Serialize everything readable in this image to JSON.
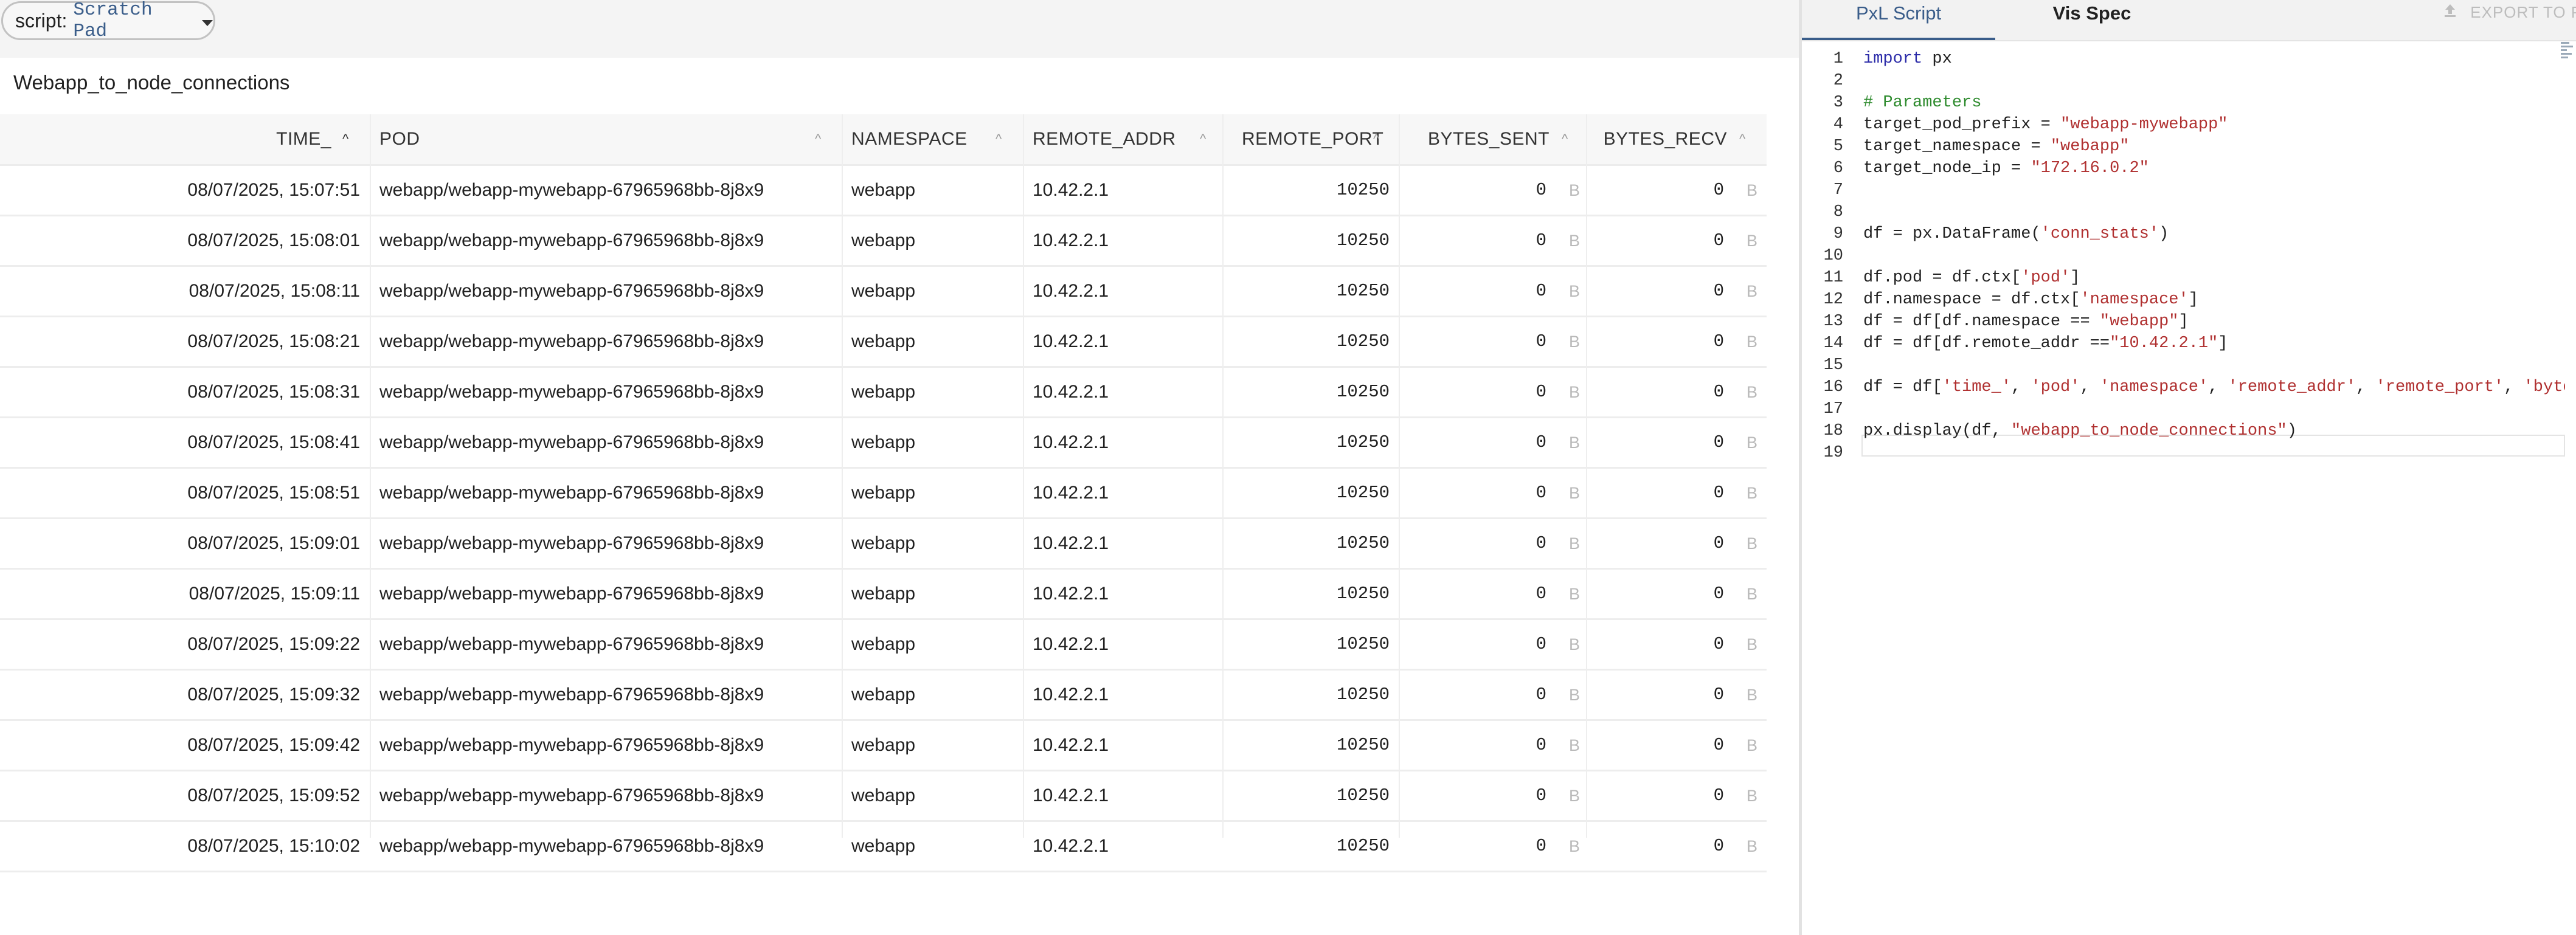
{
  "script_selector": {
    "prefix": "script:",
    "value": "Scratch Pad"
  },
  "table": {
    "title": "Webapp_to_node_connections",
    "columns": [
      "TIME_",
      "POD",
      "NAMESPACE",
      "REMOTE_ADDR",
      "REMOTE_PORT",
      "BYTES_SENT",
      "BYTES_RECV"
    ],
    "byte_unit": "B",
    "rows": [
      [
        "08/07/2025, 15:07:51",
        "webapp/webapp-mywebapp-67965968bb-8j8x9",
        "webapp",
        "10.42.2.1",
        "10250",
        "0",
        "0"
      ],
      [
        "08/07/2025, 15:08:01",
        "webapp/webapp-mywebapp-67965968bb-8j8x9",
        "webapp",
        "10.42.2.1",
        "10250",
        "0",
        "0"
      ],
      [
        "08/07/2025, 15:08:11",
        "webapp/webapp-mywebapp-67965968bb-8j8x9",
        "webapp",
        "10.42.2.1",
        "10250",
        "0",
        "0"
      ],
      [
        "08/07/2025, 15:08:21",
        "webapp/webapp-mywebapp-67965968bb-8j8x9",
        "webapp",
        "10.42.2.1",
        "10250",
        "0",
        "0"
      ],
      [
        "08/07/2025, 15:08:31",
        "webapp/webapp-mywebapp-67965968bb-8j8x9",
        "webapp",
        "10.42.2.1",
        "10250",
        "0",
        "0"
      ],
      [
        "08/07/2025, 15:08:41",
        "webapp/webapp-mywebapp-67965968bb-8j8x9",
        "webapp",
        "10.42.2.1",
        "10250",
        "0",
        "0"
      ],
      [
        "08/07/2025, 15:08:51",
        "webapp/webapp-mywebapp-67965968bb-8j8x9",
        "webapp",
        "10.42.2.1",
        "10250",
        "0",
        "0"
      ],
      [
        "08/07/2025, 15:09:01",
        "webapp/webapp-mywebapp-67965968bb-8j8x9",
        "webapp",
        "10.42.2.1",
        "10250",
        "0",
        "0"
      ],
      [
        "08/07/2025, 15:09:11",
        "webapp/webapp-mywebapp-67965968bb-8j8x9",
        "webapp",
        "10.42.2.1",
        "10250",
        "0",
        "0"
      ],
      [
        "08/07/2025, 15:09:22",
        "webapp/webapp-mywebapp-67965968bb-8j8x9",
        "webapp",
        "10.42.2.1",
        "10250",
        "0",
        "0"
      ],
      [
        "08/07/2025, 15:09:32",
        "webapp/webapp-mywebapp-67965968bb-8j8x9",
        "webapp",
        "10.42.2.1",
        "10250",
        "0",
        "0"
      ],
      [
        "08/07/2025, 15:09:42",
        "webapp/webapp-mywebapp-67965968bb-8j8x9",
        "webapp",
        "10.42.2.1",
        "10250",
        "0",
        "0"
      ],
      [
        "08/07/2025, 15:09:52",
        "webapp/webapp-mywebapp-67965968bb-8j8x9",
        "webapp",
        "10.42.2.1",
        "10250",
        "0",
        "0"
      ],
      [
        "08/07/2025, 15:10:02",
        "webapp/webapp-mywebapp-67965968bb-8j8x9",
        "webapp",
        "10.42.2.1",
        "10250",
        "0",
        "0"
      ]
    ]
  },
  "editor_tabs": {
    "pxl_script": "PxL Script",
    "vis_spec": "Vis Spec",
    "export": "EXPORT TO P"
  },
  "code_lines": [
    [
      {
        "t": "import",
        "c": "kw"
      },
      {
        "t": " px",
        "c": ""
      }
    ],
    [],
    [
      {
        "t": "# Parameters",
        "c": "cm"
      }
    ],
    [
      {
        "t": "target_pod_prefix = ",
        "c": ""
      },
      {
        "t": "\"webapp-mywebapp\"",
        "c": "str"
      }
    ],
    [
      {
        "t": "target_namespace = ",
        "c": ""
      },
      {
        "t": "\"webapp\"",
        "c": "str"
      }
    ],
    [
      {
        "t": "target_node_ip = ",
        "c": ""
      },
      {
        "t": "\"172.16.0.2\"",
        "c": "str"
      }
    ],
    [],
    [],
    [
      {
        "t": "df = px.DataFrame(",
        "c": ""
      },
      {
        "t": "'conn_stats'",
        "c": "str"
      },
      {
        "t": ")",
        "c": ""
      }
    ],
    [],
    [
      {
        "t": "df.pod = df.ctx[",
        "c": ""
      },
      {
        "t": "'pod'",
        "c": "str"
      },
      {
        "t": "]",
        "c": ""
      }
    ],
    [
      {
        "t": "df.namespace = df.ctx[",
        "c": ""
      },
      {
        "t": "'namespace'",
        "c": "str"
      },
      {
        "t": "]",
        "c": ""
      }
    ],
    [
      {
        "t": "df = df[df.namespace == ",
        "c": ""
      },
      {
        "t": "\"webapp\"",
        "c": "str"
      },
      {
        "t": "]",
        "c": ""
      }
    ],
    [
      {
        "t": "df = df[df.remote_addr ==",
        "c": ""
      },
      {
        "t": "\"10.42.2.1\"",
        "c": "str"
      },
      {
        "t": "]",
        "c": ""
      }
    ],
    [],
    [
      {
        "t": "df = df[",
        "c": ""
      },
      {
        "t": "'time_'",
        "c": "str"
      },
      {
        "t": ", ",
        "c": ""
      },
      {
        "t": "'pod'",
        "c": "str"
      },
      {
        "t": ", ",
        "c": ""
      },
      {
        "t": "'namespace'",
        "c": "str"
      },
      {
        "t": ", ",
        "c": ""
      },
      {
        "t": "'remote_addr'",
        "c": "str"
      },
      {
        "t": ", ",
        "c": ""
      },
      {
        "t": "'remote_port'",
        "c": "str"
      },
      {
        "t": ", ",
        "c": ""
      },
      {
        "t": "'bytes_sent'",
        "c": "str"
      }
    ],
    [],
    [
      {
        "t": "px.display(df, ",
        "c": ""
      },
      {
        "t": "\"webapp_to_node_connections\"",
        "c": "str"
      },
      {
        "t": ")",
        "c": ""
      }
    ],
    []
  ],
  "colors": {
    "accent": "#3a5d8a",
    "keyword": "#2a2aa8",
    "string": "#b03030",
    "comment": "#2e8b2e"
  },
  "icons": {
    "dropdown": "caret-down-icon",
    "export": "upload-icon",
    "sort": "sort-up-icon"
  }
}
